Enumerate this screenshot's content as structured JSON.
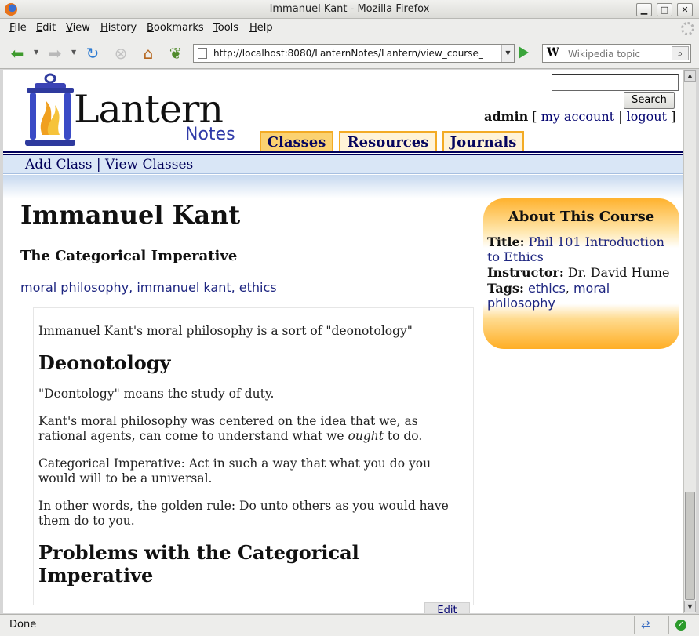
{
  "window": {
    "title": "Immanuel Kant - Mozilla Firefox"
  },
  "menu": [
    "File",
    "Edit",
    "View",
    "History",
    "Bookmarks",
    "Tools",
    "Help"
  ],
  "navbar": {
    "url": "http://localhost:8080/LanternNotes/Lantern/view_course_",
    "search_placeholder": "Wikipedia topic",
    "search_engine_glyph": "W"
  },
  "site": {
    "logo_word": "Lantern",
    "logo_sub": "Notes",
    "search_button": "Search",
    "user": "admin",
    "my_account": "my account",
    "logout": "logout",
    "tabs": [
      "Classes",
      "Resources",
      "Journals"
    ],
    "active_tab": "Classes",
    "subnav": {
      "add": "Add Class",
      "sep": "|",
      "view": "View Classes"
    }
  },
  "note": {
    "title": "Immanuel Kant",
    "subtitle": "The Categorical Imperative",
    "tags": [
      "moral philosophy",
      "immanuel kant",
      "ethics"
    ],
    "body": {
      "intro": "Immanuel Kant's moral philosophy is a sort of \"deonotology\"",
      "heading1": "Deonotology",
      "p1": " \"Deontology\" means the study of duty.",
      "p2_before": " Kant's moral philosophy was centered on the idea that we, as rational agents, can come to understand what we ",
      "p2_em": "ought",
      "p2_after": " to do.",
      "p3": "Categorical Imperative: Act in such a way that what you do you would will to be a universal.",
      "p4": " In other words, the golden rule: Do unto others as you would have them do to you.",
      "heading2": "Problems with the Categorical Imperative"
    },
    "edit_label": "Edit"
  },
  "about": {
    "heading": "About This Course",
    "title_label": "Title:",
    "title_value": "Phil 101 Introduction to Ethics",
    "instructor_label": "Instructor:",
    "instructor_value": "Dr. David Hume",
    "tags_label": "Tags:",
    "tags": [
      "ethics",
      "moral philosophy"
    ]
  },
  "status": {
    "text": "Done"
  },
  "colors": {
    "navy": "#00005a",
    "tab_orange": "#f3ab25",
    "tab_active": "#fbd271",
    "subnav_bg": "#d9e6f6",
    "link_blue": "#1d2580",
    "about_orange": "#ffb22e"
  }
}
